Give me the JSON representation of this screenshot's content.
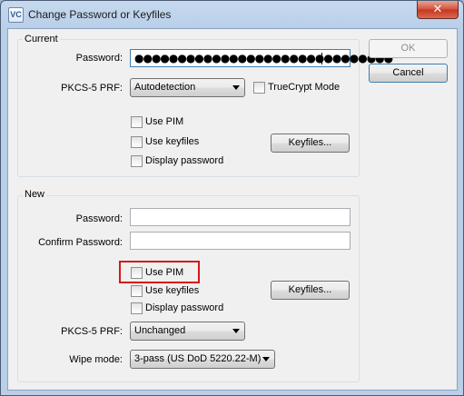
{
  "window": {
    "title": "Change Password or Keyfiles",
    "close_symbol": "✕",
    "icon_text": "VC"
  },
  "current": {
    "group_label": "Current",
    "password_label": "Password:",
    "password_mask": "●●●●●●●●●●●●●●●●●●●●●●●●●●●●●●",
    "prf_label": "PKCS-5 PRF:",
    "prf_value": "Autodetection",
    "truecrypt_mode": "TrueCrypt Mode",
    "use_pim": "Use PIM",
    "use_keyfiles": "Use keyfiles",
    "display_password": "Display password",
    "keyfiles_button": "Keyfiles..."
  },
  "new": {
    "group_label": "New",
    "password_label": "Password:",
    "confirm_label": "Confirm Password:",
    "use_pim": "Use PIM",
    "use_keyfiles": "Use keyfiles",
    "display_password": "Display password",
    "keyfiles_button": "Keyfiles...",
    "prf_label": "PKCS-5 PRF:",
    "prf_value": "Unchanged",
    "wipe_label": "Wipe mode:",
    "wipe_value": "3-pass (US DoD 5220.22-M)"
  },
  "buttons": {
    "ok": "OK",
    "cancel": "Cancel"
  },
  "colors": {
    "highlight": "#d9141b",
    "close_button": "#c2371f"
  }
}
